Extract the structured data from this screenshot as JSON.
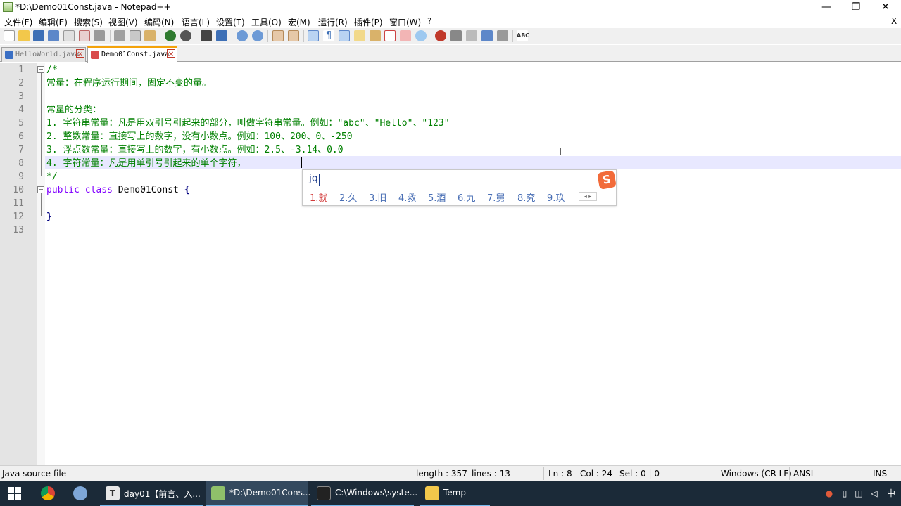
{
  "window": {
    "title": "*D:\\Demo01Const.java - Notepad++",
    "minimize_glyph": "—",
    "maximize_glyph": "❐",
    "close_glyph": "✕"
  },
  "menu": {
    "items": [
      "文件(F)",
      "编辑(E)",
      "搜索(S)",
      "视图(V)",
      "编码(N)",
      "语言(L)",
      "设置(T)",
      "工具(O)",
      "宏(M)",
      "运行(R)",
      "插件(P)",
      "窗口(W)",
      "?"
    ],
    "close_doc": "X"
  },
  "tabs": [
    {
      "label": "HelloWorld.java",
      "active": false,
      "icon_color": "#3a6fc4"
    },
    {
      "label": "Demo01Const.java",
      "active": true,
      "icon_color": "#d94b4b"
    }
  ],
  "editor": {
    "line_numbers": [
      "1",
      "2",
      "3",
      "4",
      "5",
      "6",
      "7",
      "8",
      "9",
      "10",
      "11",
      "12",
      "13"
    ],
    "lines": {
      "l1": "/*",
      "l2": "常量：在程序运行期间，固定不变的量。",
      "l3": "",
      "l4": "常量的分类：",
      "l5": "1. 字符串常量：凡是用双引号引起来的部分，叫做字符串常量。例如：\"abc\"、\"Hello\"、\"123\"",
      "l6": "2. 整数常量：直接写上的数字，没有小数点。例如：100、200、0、-250",
      "l7": "3. 浮点数常量：直接写上的数字，有小数点。例如：2.5、-3.14、0.0",
      "l8": "4. 字符常量：凡是用单引号引起来的单个字符，",
      "l9": "*/",
      "l10_kw1": "public",
      "l10_kw2": "class",
      "l10_name": "Demo01Const",
      "l10_brace": "{",
      "l11": "",
      "l12_brace": "}",
      "l13": ""
    },
    "colors": {
      "comment": "#008000",
      "keyword": "#8000ff",
      "current_line": "#e8e8ff"
    },
    "ibeam": "I"
  },
  "ime": {
    "input": "jq",
    "candidates": [
      "1.就",
      "2.久",
      "3.旧",
      "4.救",
      "5.酒",
      "6.九",
      "7.舅",
      "8.究",
      "9.玖"
    ],
    "pager": "◂ ▸",
    "logo": "S"
  },
  "status": {
    "file_type": "Java source file",
    "length": "length : 357",
    "lines": "lines : 13",
    "ln": "Ln : 8",
    "col": "Col : 24",
    "sel": "Sel : 0 | 0",
    "eol": "Windows (CR LF)",
    "encoding": "ANSI",
    "mode": "INS"
  },
  "taskbar": {
    "apps": [
      {
        "label": "day01【前言、入...",
        "icon_color": "#e8e8e8"
      },
      {
        "label": "*D:\\Demo01Cons...",
        "icon_color": "#8fc06a"
      },
      {
        "label": "C:\\Windows\\syste...",
        "icon_color": "#222222"
      },
      {
        "label": "Temp",
        "icon_color": "#f2c84b"
      }
    ],
    "tray_lang": "中"
  }
}
